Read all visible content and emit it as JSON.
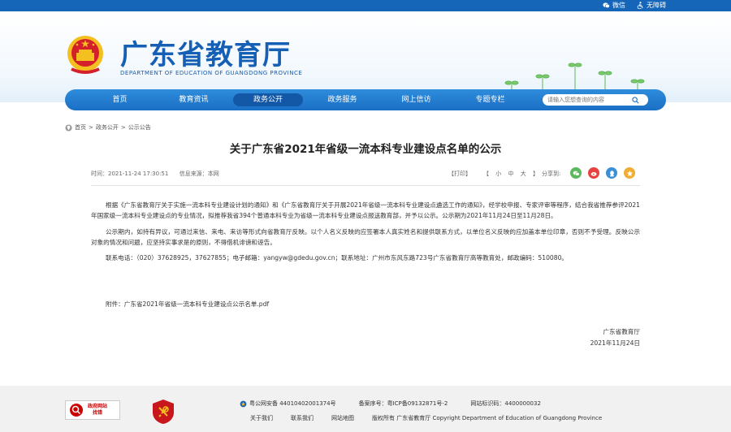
{
  "top_links": {
    "wechat": "微信",
    "accessibility": "无障碍"
  },
  "site": {
    "title": "广东省教育厅",
    "subtitle": "DEPARTMENT OF EDUCATION OF GUANGDONG PROVINCE"
  },
  "nav": {
    "items": [
      "首页",
      "教育资讯",
      "政务公开",
      "政务服务",
      "网上信访",
      "专题专栏"
    ],
    "active_index": 2,
    "search_placeholder": "请输入您想查询的内容"
  },
  "breadcrumb": [
    "首页",
    "政务公开",
    "公示公告"
  ],
  "breadcrumb_sep": ">",
  "article": {
    "title": "关于广东省2021年省级一流本科专业建设点名单的公示",
    "time_label": "时间：",
    "time": "2021-11-24 17:30:51",
    "source_label": "信息来源：",
    "source": "本网",
    "print": "【打印】",
    "font_size_open": "【",
    "font_small": "小",
    "font_medium": "中",
    "font_large": "大",
    "font_size_close": "】",
    "share_label": "分享到:",
    "paragraphs": [
      "根据《广东省教育厅关于实施一流本科专业建设计划的通知》和《广东省教育厅关于开展2021年省级一流本科专业建设点遴选工作的通知》，经学校申报、专家评审等程序，结合我省推荐参评2021年国家级一流本科专业建设点的专业情况，拟推荐我省394个普通本科专业为省级一流本科专业建设点报送教育部，并予以公示。公示期为2021年11月24日至11月28日。",
      "公示期内，如持有异议，可通过来信、来电、来访等形式向省教育厅反映。以个人名义反映的应签署本人真实姓名和提供联系方式，以单位名义反映的应加盖本单位印章，否则不予受理。反映公示对象的情况和问题，应坚持实事求是的原则，不得借机诽谤和诬告。",
      "联系电话：（020）37628925，37627855；电子邮箱：yangyw@gdedu.gov.cn；联系地址：广州市东风东路723号广东省教育厅高等教育处，邮政编码：510080。"
    ],
    "attachment_label": "附件：",
    "attachment_name": "广东省2021年省级一流本科专业建设点公示名单.pdf",
    "sign_org": "广东省教育厅",
    "sign_date": "2021年11月24日"
  },
  "footer": {
    "gov_badge_line1": "政府网站",
    "gov_badge_line2": "找错",
    "police_record": "粤公网安备 44010402001374号",
    "icp_record": "备案序号：粤ICP备09132871号-2",
    "site_id": "网站标识码：4400000032",
    "links": [
      "关于我们",
      "联系我们",
      "网站地图"
    ],
    "copyright": "版权所有 广东省教育厅 Copyright Department of Education of Guangdong Province"
  },
  "colors": {
    "brand_blue": "#1560b5",
    "nav_blue": "#1a6fc4",
    "emblem_red": "#d4202a",
    "emblem_gold": "#f4c020"
  }
}
